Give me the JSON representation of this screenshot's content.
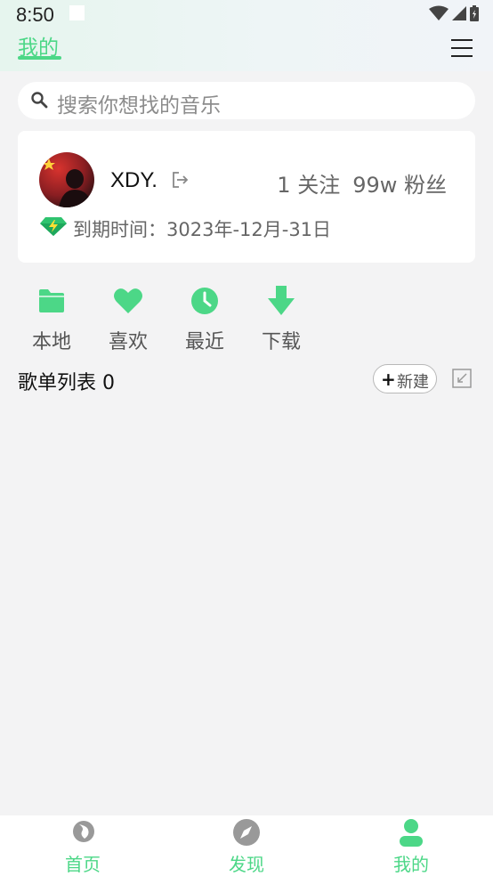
{
  "status_bar": {
    "time": "8:50"
  },
  "header": {
    "active_tab": "我的"
  },
  "search": {
    "placeholder": "搜索你想找的音乐"
  },
  "profile": {
    "username": "XDY.",
    "following": "1 关注",
    "followers": "99w 粉丝",
    "expire_text": "到期时间：3023年-12月-31日"
  },
  "quick_actions": [
    {
      "label": "本地",
      "icon": "folder-icon"
    },
    {
      "label": "喜欢",
      "icon": "heart-icon"
    },
    {
      "label": "最近",
      "icon": "clock-icon"
    },
    {
      "label": "下载",
      "icon": "download-icon"
    }
  ],
  "playlist": {
    "header": "歌单列表 0",
    "new_label": "新建"
  },
  "bottom_nav": [
    {
      "label": "首页",
      "icon": "home-icon"
    },
    {
      "label": "发现",
      "icon": "compass-icon"
    },
    {
      "label": "我的",
      "icon": "person-icon"
    }
  ],
  "colors": {
    "accent": "#4cd787",
    "background": "#f3f3f4",
    "card": "#ffffff"
  }
}
